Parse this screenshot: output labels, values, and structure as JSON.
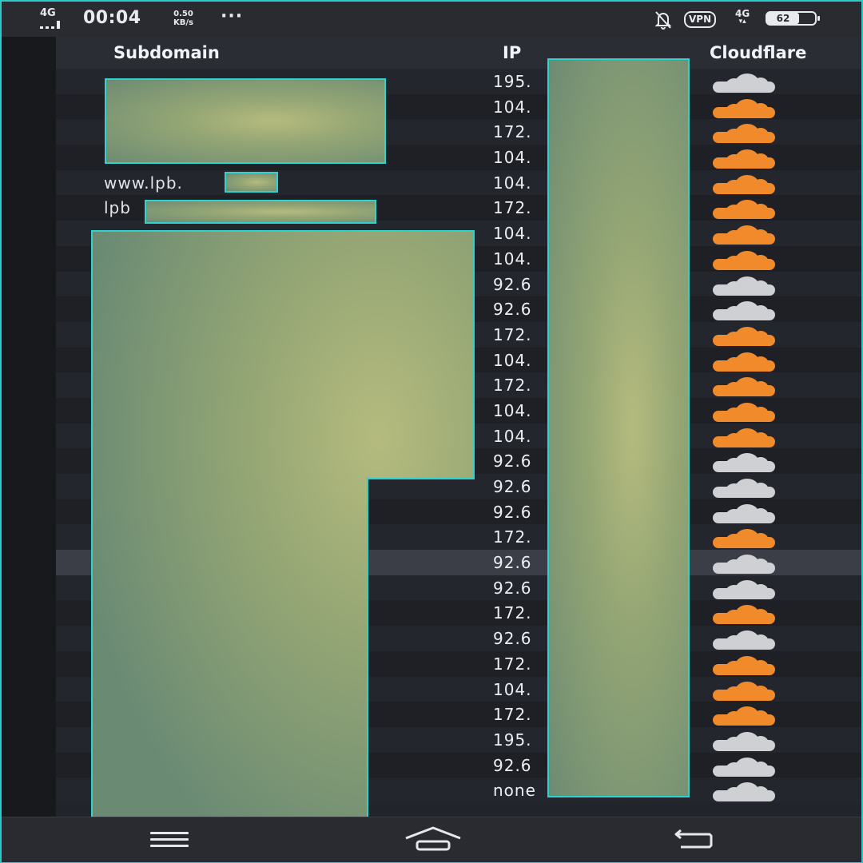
{
  "status_bar": {
    "network": "4G",
    "time": "00:04",
    "speed_value": "0.50",
    "speed_unit": "KB/s",
    "more": "···",
    "vpn": "VPN",
    "network2": "4G",
    "battery": "62",
    "icons": [
      "signal-icon",
      "mute-bell-icon",
      "battery-icon"
    ]
  },
  "table": {
    "headers": {
      "subdomain": "Subdomain",
      "ip": "IP",
      "cloudflare": "Cloudflare"
    },
    "colors": {
      "cloudflare_on": "#f18a2b",
      "cloudflare_off": "#cfd0d4"
    },
    "rows": [
      {
        "subdomain": "",
        "ip": "195.",
        "cloudflare": false
      },
      {
        "subdomain": "",
        "ip": "104.",
        "cloudflare": true
      },
      {
        "subdomain": "",
        "ip": "172.",
        "cloudflare": true
      },
      {
        "subdomain": "",
        "ip": "104.",
        "cloudflare": true
      },
      {
        "subdomain": "www.lpb.",
        "ip": "104.",
        "cloudflare": true
      },
      {
        "subdomain": "lpb",
        "ip": "172.",
        "cloudflare": true
      },
      {
        "subdomain": "",
        "ip": "104.",
        "cloudflare": true
      },
      {
        "subdomain": "",
        "ip": "104.",
        "cloudflare": true
      },
      {
        "subdomain": "",
        "ip": "92.6",
        "cloudflare": false
      },
      {
        "subdomain": "",
        "ip": "92.6",
        "cloudflare": false
      },
      {
        "subdomain": "",
        "ip": "172.",
        "cloudflare": true
      },
      {
        "subdomain": "",
        "ip": "104.",
        "cloudflare": true
      },
      {
        "subdomain": "",
        "ip": "172.",
        "cloudflare": true
      },
      {
        "subdomain": "",
        "ip": "104.",
        "cloudflare": true
      },
      {
        "subdomain": "",
        "ip": "104.",
        "cloudflare": true
      },
      {
        "subdomain": "",
        "ip": "92.6",
        "cloudflare": false
      },
      {
        "subdomain": "",
        "ip": "92.6",
        "cloudflare": false
      },
      {
        "subdomain": "",
        "ip": "92.6",
        "cloudflare": false
      },
      {
        "subdomain": "",
        "ip": "172.",
        "cloudflare": true
      },
      {
        "subdomain": "",
        "ip": "92.6",
        "cloudflare": false
      },
      {
        "subdomain": "",
        "ip": "92.6",
        "cloudflare": false
      },
      {
        "subdomain": "",
        "ip": "172.",
        "cloudflare": true
      },
      {
        "subdomain": "",
        "ip": "92.6",
        "cloudflare": false
      },
      {
        "subdomain": "",
        "ip": "172.",
        "cloudflare": true
      },
      {
        "subdomain": "",
        "ip": "104.",
        "cloudflare": true
      },
      {
        "subdomain": "",
        "ip": "172.",
        "cloudflare": true
      },
      {
        "subdomain": "",
        "ip": "195.",
        "cloudflare": false
      },
      {
        "subdomain": "",
        "ip": "92.6",
        "cloudflare": false
      },
      {
        "subdomain": "",
        "ip": "none",
        "cloudflare": false
      }
    ]
  },
  "nav_bar": {
    "icons": [
      "menu-icon",
      "home-icon",
      "back-icon"
    ]
  }
}
